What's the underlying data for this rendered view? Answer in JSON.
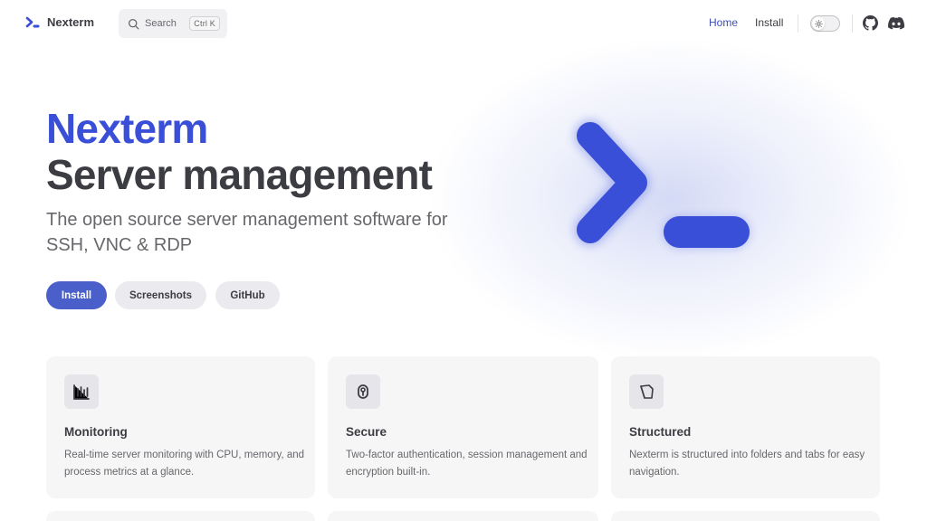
{
  "nav": {
    "brand": "Nexterm",
    "search_label": "Search",
    "search_shortcut": "Ctrl K",
    "links": [
      "Home",
      "Install"
    ],
    "icons": [
      "sun-icon",
      "github-icon",
      "discord-icon"
    ]
  },
  "hero": {
    "title": "Nexterm",
    "subtitle": "Server management",
    "tagline": "The open source server management software for SSH, VNC & RDP",
    "buttons": [
      "Install",
      "Screenshots",
      "GitHub"
    ],
    "accent_color": "#3a4fd8"
  },
  "features": [
    {
      "icon": "bar-chart-icon",
      "title": "Monitoring",
      "desc": "Real-time server monitoring with CPU, memory, and process metrics at a glance."
    },
    {
      "icon": "lock-icon",
      "title": "Secure",
      "desc": "Two-factor authentication, session management and encryption built-in."
    },
    {
      "icon": "folder-icon",
      "title": "Structured",
      "desc": "Nexterm is structured into folders and tabs for easy navigation."
    }
  ]
}
